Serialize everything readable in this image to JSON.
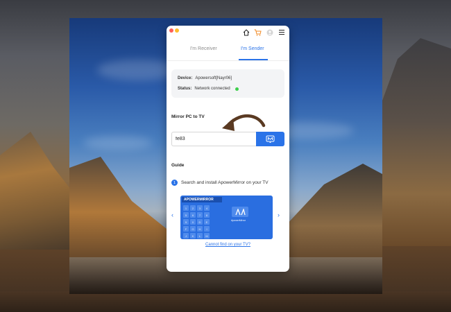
{
  "window": {
    "tabs": [
      {
        "label": "I'm Receiver",
        "active": false
      },
      {
        "label": "I'm Sender",
        "active": true
      }
    ],
    "top_icons": [
      "home-icon",
      "cart-icon",
      "avatar-icon",
      "menu-icon"
    ]
  },
  "device": {
    "device_label": "Device:",
    "device_value": "Apowersoft[Nayr06]",
    "status_label": "Status:",
    "status_value": "Network connected"
  },
  "mirror": {
    "title": "Mirror PC to TV",
    "code_value": "fe83"
  },
  "guide": {
    "title": "Guide",
    "step_number": "1",
    "step_text": "Search and install ApowerMirror on your TV"
  },
  "promo": {
    "brand_title": "APOWERMIRROR",
    "keys": [
      "1",
      "2",
      "3",
      "4",
      "5",
      "6",
      "7",
      "8",
      "9",
      "0",
      "D",
      "E",
      "F",
      "G",
      "H",
      "I",
      "J",
      "K",
      "L",
      "M",
      "N",
      "O"
    ],
    "brand_caption": "ApowerMirror"
  },
  "help_link": "Cannot find on your TV?",
  "colors": {
    "accent": "#2a73e8",
    "status_green": "#3ecf4c",
    "arrow": "#5a3a22"
  }
}
